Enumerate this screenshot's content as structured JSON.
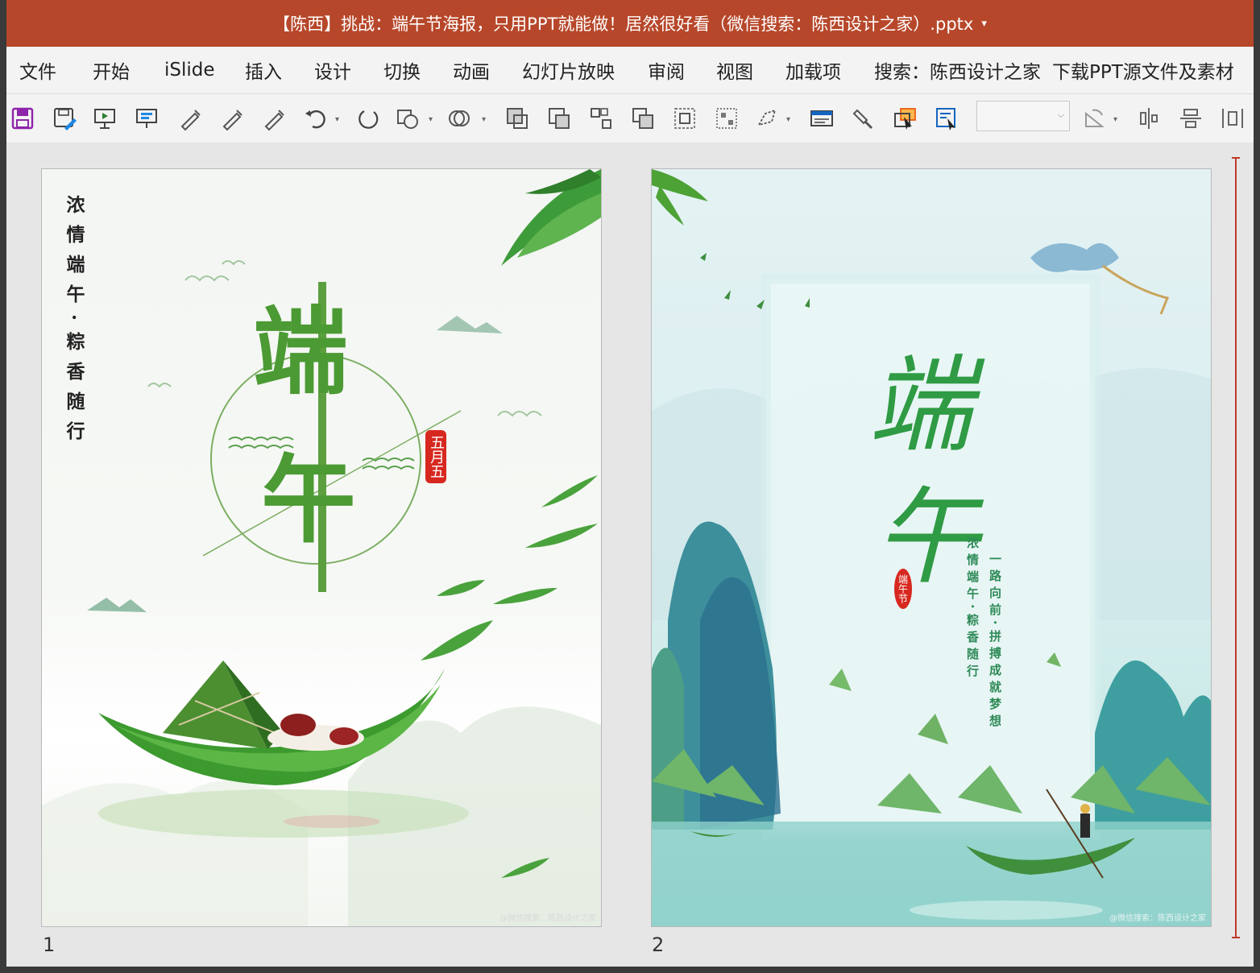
{
  "window": {
    "title": "【陈西】挑战：端午节海报，只用PPT就能做！居然很好看（微信搜索：陈西设计之家）.pptx",
    "title_caret": "▾"
  },
  "menu": [
    "文件",
    "开始",
    "iSlide",
    "插入",
    "设计",
    "切换",
    "动画",
    "幻灯片放映",
    "审阅",
    "视图",
    "加载项",
    "搜索：陈西设计之家",
    "下载PPT源文件及素材"
  ],
  "toolbar": {
    "icons": [
      "save-icon",
      "save-as-icon",
      "present-icon",
      "present-from-current-icon",
      "pen-icon",
      "highlighter-icon",
      "eraser-icon",
      "undo-icon",
      "redo-icon",
      "shape-icon",
      "merge-shapes-icon",
      "bring-forward-icon",
      "send-backward-icon",
      "group-icon",
      "ungroup-icon",
      "align-icon",
      "distribute-icon",
      "crop-icon",
      "textbox-icon",
      "format-painter-icon",
      "select-icon",
      "selection-pane-icon",
      "rotate-icon",
      "align-center-icon",
      "align-middle-icon",
      "distribute-h-icon"
    ],
    "combo_value": ""
  },
  "slides": [
    {
      "number": "1",
      "vertical_text": "浓情端午·粽香随行",
      "title_1": "端",
      "title_2": "午",
      "seal": "五月五",
      "watermark": "@微信搜索：陈西设计之家"
    },
    {
      "number": "2",
      "title_1": "端",
      "title_2": "午",
      "seal": "端午节",
      "poem_1": "浓情端午·粽香随行",
      "poem_2": "一路向前·拼搏成就梦想",
      "watermark": "@微信搜索：陈西设计之家"
    }
  ],
  "colors": {
    "titlebar": "#b7472a",
    "green_dark": "#2e7d32",
    "green_mid": "#4caf50",
    "teal": "#3a9e9a",
    "red_seal": "#d32f2f"
  }
}
